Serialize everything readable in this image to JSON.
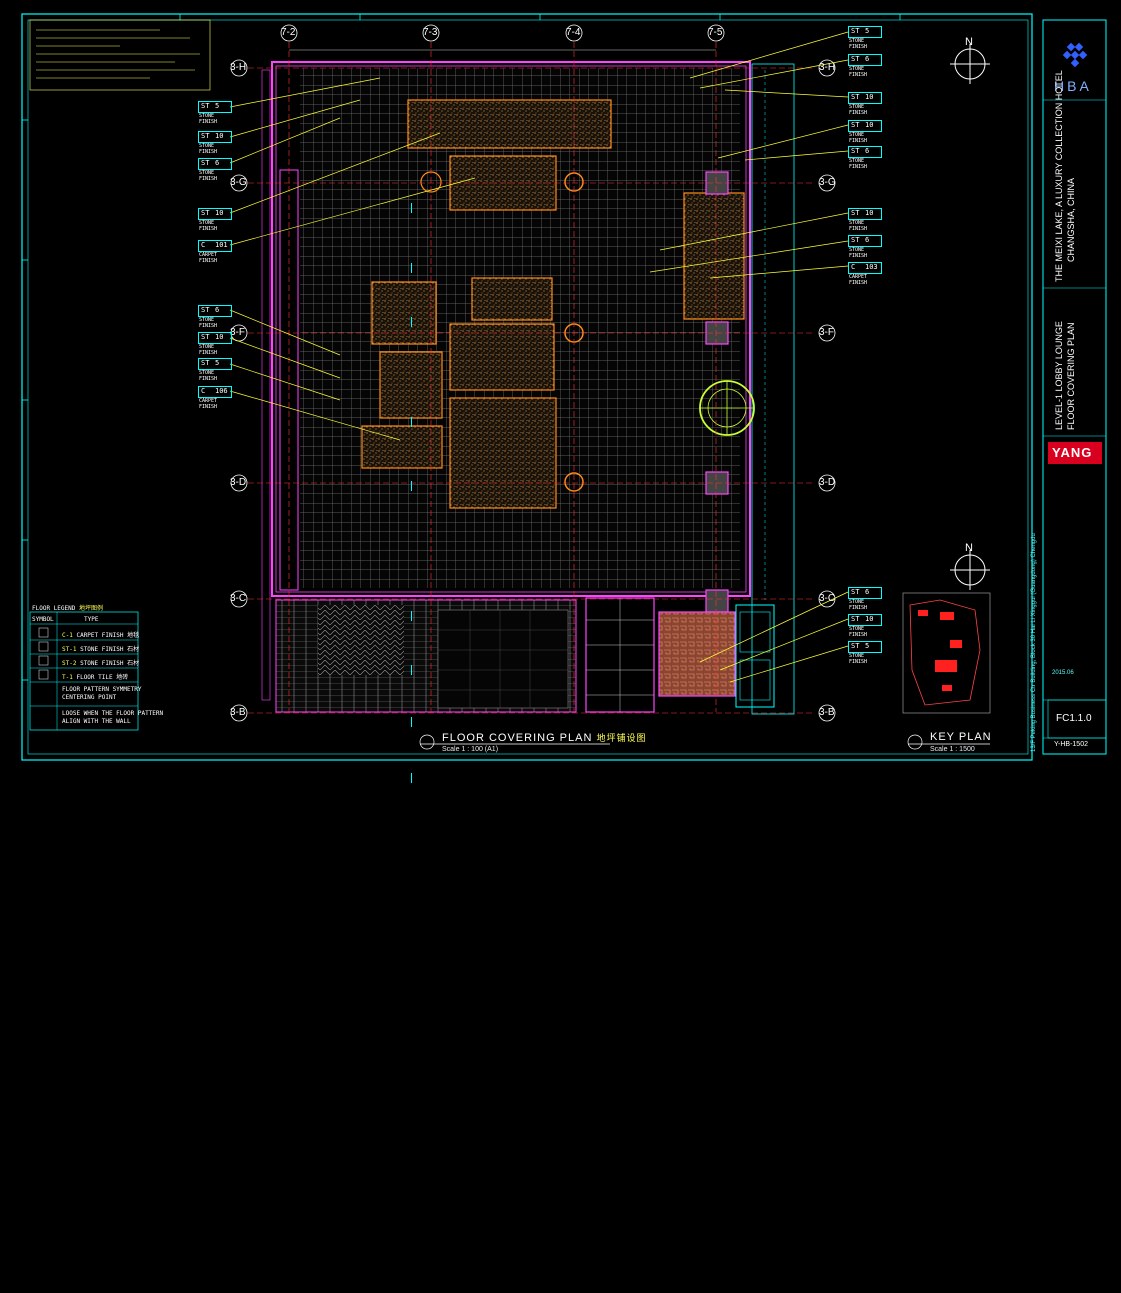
{
  "drawing": {
    "title": "FLOOR COVERING PLAN",
    "title_cn": "地坪铺设图",
    "scale": "Scale 1 : 100 (A1)",
    "key_plan_title": "KEY PLAN",
    "key_plan_scale": "Scale 1 : 1500",
    "sheet_no": "FC1.1.0",
    "drawing_code": "Y-HB-1502",
    "company": "YANG",
    "logo_text": "HBA",
    "project_line1": "THE MEIXI LAKE, A LUXURY COLLECTION HOTEL",
    "project_line2": "CHANGSHA, CHINA",
    "sheet_title_line1": "LEVEL-1 LOBBY LOUNGE",
    "sheet_title_line2": "FLOOR COVERING PLAN",
    "bottom_vertical_note": "13/F Peking Business Ctr Building, Block 30 Hai Li Xinggui (Guangdong) Chengdu",
    "colors": {
      "background": "#000000",
      "frame": "#00ffff",
      "wall": "#ff44ff",
      "carpet": "#ff8c1a",
      "leader": "#ffff33",
      "grid": "#707070",
      "brown": "#b05a30"
    }
  },
  "gridlines": {
    "columns": [
      "7-2",
      "7-3",
      "7-4",
      "7-5"
    ],
    "rows": [
      "3-H",
      "3-G",
      "3-F",
      "3-D",
      "3-C",
      "3-B"
    ]
  },
  "tags": [
    {
      "code": "ST",
      "num": "5",
      "label": "STONE FINISH"
    },
    {
      "code": "ST",
      "num": "10",
      "label": "STONE FINISH"
    },
    {
      "code": "ST",
      "num": "6",
      "label": "STONE FINISH"
    },
    {
      "code": "ST",
      "num": "10",
      "label": "STONE FINISH"
    },
    {
      "code": "C",
      "num": "101",
      "label": "CARPET FINISH"
    },
    {
      "code": "ST",
      "num": "6",
      "label": "STONE FINISH"
    },
    {
      "code": "ST",
      "num": "10",
      "label": "STONE FINISH"
    },
    {
      "code": "ST",
      "num": "5",
      "label": "STONE FINISH"
    },
    {
      "code": "C",
      "num": "106",
      "label": "CARPET FINISH"
    }
  ],
  "right_tags": [
    {
      "code": "ST",
      "num": "5",
      "label": "STONE FINISH"
    },
    {
      "code": "ST",
      "num": "6",
      "label": "STONE FINISH"
    },
    {
      "code": "ST",
      "num": "10",
      "label": "STONE FINISH"
    },
    {
      "code": "ST",
      "num": "10",
      "label": "STONE FINISH"
    },
    {
      "code": "ST",
      "num": "6",
      "label": "STONE FINISH"
    },
    {
      "code": "ST",
      "num": "10",
      "label": "STONE FINISH"
    },
    {
      "code": "ST",
      "num": "6",
      "label": "STONE FINISH"
    },
    {
      "code": "C",
      "num": "103",
      "label": "CARPET FINISH"
    },
    {
      "code": "ST",
      "num": "6",
      "label": "STONE FINISH"
    },
    {
      "code": "ST",
      "num": "10",
      "label": "STONE FINISH"
    },
    {
      "code": "ST",
      "num": "5",
      "label": "STONE FINISH"
    }
  ],
  "legend": {
    "header": "FLOOR LEGEND",
    "header_cn": "地坪图例",
    "col1": "SYMBOL",
    "col2": "TYPE",
    "rows": [
      {
        "code": "C-1",
        "desc": "CARPET FINISH",
        "cn": "地毯"
      },
      {
        "code": "ST-1",
        "desc": "STONE FINISH",
        "cn": "石材"
      },
      {
        "code": "ST-2",
        "desc": "STONE FINISH",
        "cn": "石材"
      },
      {
        "code": "T-1",
        "desc": "FLOOR TILE",
        "cn": "地砖"
      }
    ],
    "note1": "FLOOR PATTERN SYMMETRY",
    "note2": "CENTERING POINT",
    "note3": "LOOSE WHEN THE FLOOR PATTERN",
    "note4": "ALIGN WITH THE WALL"
  },
  "north_label": "N",
  "date_label": "2015.06"
}
